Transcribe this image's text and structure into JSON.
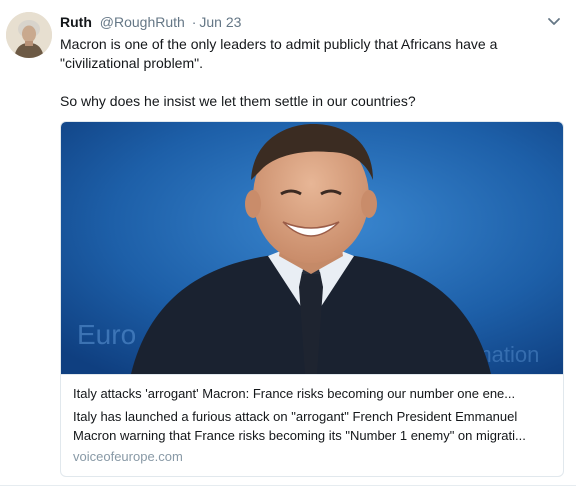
{
  "tweet": {
    "author_name": "Ruth",
    "author_handle": "@RoughRuth",
    "separator": "·",
    "timestamp": "Jun 23",
    "caret_icon": "chevron-down-icon",
    "text_line_1": "Macron is one of the only leaders to admit publicly that Africans have a \"civilizational problem\".",
    "text_line_2": "So why does he insist we let them settle in our countries?"
  },
  "card": {
    "title": "Italy attacks 'arrogant' Macron: France risks becoming our number one ene...",
    "description_line_1": "Italy has launched a furious attack on \"arrogant\" French President Emmanuel",
    "description_line_2": "Macron warning that France risks becoming its \"Number 1 enemy\" on migrati...",
    "domain": "voiceofeurope.com"
  },
  "colors": {
    "name": "#14171a",
    "meta": "#657786",
    "domain": "#8899a6",
    "card_border": "#e1e8ed",
    "photo_background": "#1b5fa8"
  }
}
